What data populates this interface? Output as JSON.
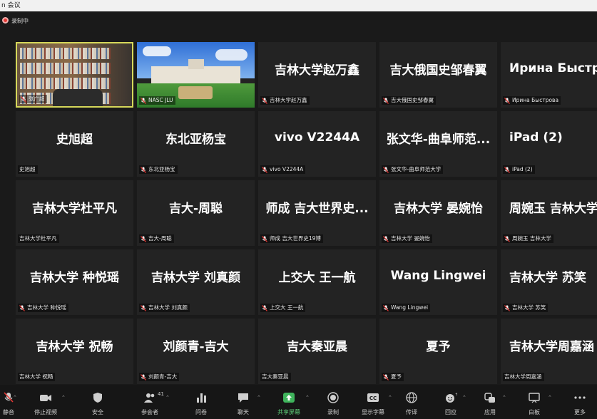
{
  "window": {
    "title": "n 会议"
  },
  "recording": {
    "label": "录制中"
  },
  "tiles": [
    {
      "name": "",
      "label": "张广超",
      "video": "bookshelf",
      "muted": true,
      "active": true
    },
    {
      "name": "",
      "label": "NASC JLU",
      "video": "campus",
      "muted": true
    },
    {
      "name": "吉林大学赵万鑫",
      "label": "吉林大学赵万鑫",
      "muted": true
    },
    {
      "name": "吉大俄国史邹春翼",
      "label": "吉大俄国史邹春翼",
      "muted": true
    },
    {
      "name": "Ирина Быстро",
      "label": "Ирина Быстрова",
      "muted": true
    },
    {
      "name": "史旭超",
      "label": "史旭超",
      "muted": false
    },
    {
      "name": "东北亚杨宝",
      "label": "东北亚杨宝",
      "muted": true
    },
    {
      "name": "vivo V2244A",
      "label": "vivo V2244A",
      "muted": true
    },
    {
      "name": "张文华-曲阜师范...",
      "label": "张文华-曲阜师范大学",
      "muted": true
    },
    {
      "name": "iPad (2)",
      "label": "iPad (2)",
      "muted": true
    },
    {
      "name": "吉林大学杜平凡",
      "label": "吉林大学杜平凡",
      "muted": false
    },
    {
      "name": "吉大-周聪",
      "label": "吉大-周聪",
      "muted": true
    },
    {
      "name": "师成 吉大世界史...",
      "label": "师成 吉大世界史19博",
      "muted": true
    },
    {
      "name": "吉林大学 晏婉怡",
      "label": "吉林大学 晏婉怡",
      "muted": true
    },
    {
      "name": "周婉玉 吉林大学",
      "label": "周婉玉 吉林大学",
      "muted": true
    },
    {
      "name": "吉林大学 种悦瑶",
      "label": "吉林大学 种悦瑶",
      "muted": true
    },
    {
      "name": "吉林大学 刘真颜",
      "label": "吉林大学 刘真颜",
      "muted": true
    },
    {
      "name": "上交大  王一航",
      "label": "上交大  王一航",
      "muted": true
    },
    {
      "name": "Wang Lingwei",
      "label": "Wang Lingwei",
      "muted": true
    },
    {
      "name": "吉林大学 苏笑",
      "label": "吉林大学 苏笑",
      "muted": true
    },
    {
      "name": "吉林大学 祝畅",
      "label": "吉林大学 祝畅",
      "muted": false
    },
    {
      "name": "刘颜青-吉大",
      "label": "刘颜青-吉大",
      "muted": true
    },
    {
      "name": "吉大秦亚晨",
      "label": "吉大秦亚晨",
      "muted": false
    },
    {
      "name": "夏予",
      "label": "夏予",
      "muted": true
    },
    {
      "name": "吉林大学周嘉涵",
      "label": "吉林大学周嘉涵",
      "muted": false
    }
  ],
  "toolbar": {
    "mute": "静音",
    "stop_video": "停止视频",
    "security": "安全",
    "participants": "参会者",
    "participants_count": "41",
    "polls": "问卷",
    "chat": "聊天",
    "share_screen": "共享屏幕",
    "record": "录制",
    "captions": "显示字幕",
    "interpretation": "传译",
    "reactions": "回应",
    "apps": "应用",
    "whiteboard": "白板",
    "more": "更多"
  },
  "colors": {
    "active_border": "#d6d85a",
    "share_green": "#5fd07a",
    "rec_red": "#e53935"
  }
}
